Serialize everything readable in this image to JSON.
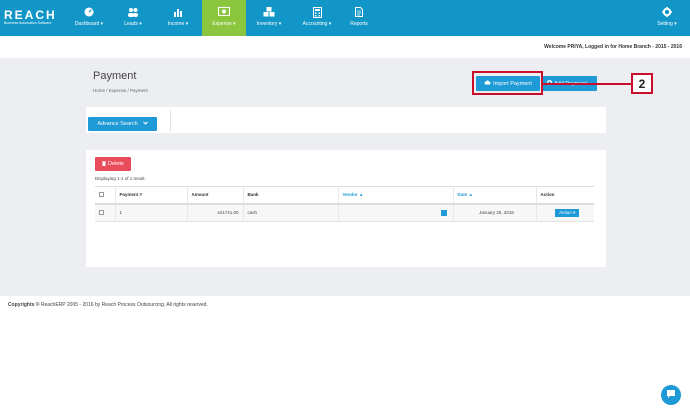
{
  "brand": {
    "logo": "REACH",
    "tagline": "Business Automation Software"
  },
  "nav": {
    "items": [
      {
        "label": "Dashboard ▾",
        "icon": "dashboard-icon"
      },
      {
        "label": "Leads ▾",
        "icon": "people-icon"
      },
      {
        "label": "Income ▾",
        "icon": "bar-chart-icon"
      },
      {
        "label": "Expense ▾",
        "icon": "money-icon"
      },
      {
        "label": "Inventory ▾",
        "icon": "cubes-icon"
      },
      {
        "label": "Accounting ▾",
        "icon": "calculator-icon"
      },
      {
        "label": "Reports",
        "icon": "document-icon"
      },
      {
        "label": "Setting ▾",
        "icon": "gear-icon"
      }
    ]
  },
  "welcome": "Welcome PRIYA, Logged in for Home Branch - 2015 - 2016",
  "page": {
    "title": "Payment",
    "breadcrumb": "Home  /  Expense  /  Payment",
    "import_label": "Import Payment",
    "add_label": "Add Payment",
    "callout_number": "2",
    "advance_search_label": "Advance Search",
    "delete_label": "Delete",
    "displaying": "Displaying 1-1 of 1 result."
  },
  "table": {
    "headers": {
      "payment": "Payment #",
      "amount": "Amount",
      "bank": "Bank",
      "vendor": "Vendor ▲",
      "date": "Date ▲",
      "action": "Action"
    },
    "rows": [
      {
        "payment": "1",
        "amount": "441741.00",
        "bank": "cash",
        "vendor": "",
        "date": "January 25, 2016",
        "action": "Action ▾"
      }
    ]
  },
  "footer": {
    "copyright_bold": "Copyrights ©",
    "copyright_text": "ReachERP 2005 - 2016 by Reach Process Outsourcing. All rights reserved."
  },
  "colors": {
    "nav": "#1296c8",
    "active": "#8cc63f",
    "accent": "#1e9ad6",
    "danger": "#e94d5b",
    "callout": "#c8102e"
  }
}
